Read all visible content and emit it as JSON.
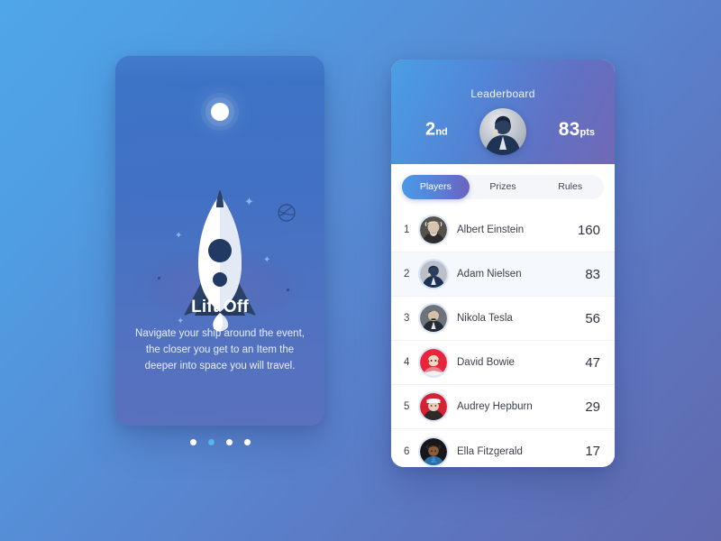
{
  "background": {
    "gradient_from": "#4fa6e8",
    "gradient_to": "#6069ae"
  },
  "onboarding_card": {
    "title": "Lift Off",
    "body": "Navigate your ship around the event, the closer you get to an Item the deeper into space you will travel.",
    "illustration": {
      "sun_label": "sun",
      "rocket_label": "rocket",
      "planet_label": "planet",
      "satellite_label": "satellite"
    },
    "pagination": {
      "total": 4,
      "active_index": 1
    },
    "colors": {
      "card_from": "#3c74c7",
      "card_to": "#5a71bd",
      "active_dot": "#52b6f0",
      "inactive_dot": "#ffffff"
    }
  },
  "leaderboard_card": {
    "header": {
      "title": "Leaderboard",
      "rank_value": "2",
      "rank_suffix": "nd",
      "points_value": "83",
      "points_suffix": "pts",
      "avatar_label": "current-user-avatar"
    },
    "tabs": [
      {
        "label": "Players",
        "active": true
      },
      {
        "label": "Prizes",
        "active": false
      },
      {
        "label": "Rules",
        "active": false
      }
    ],
    "players": [
      {
        "rank": "1",
        "name": "Albert Einstein",
        "score": "160",
        "highlight": false,
        "avatar_bg": "#5c5a56",
        "avatar_label": "avatar-albert-einstein"
      },
      {
        "rank": "2",
        "name": "Adam Nielsen",
        "score": "83",
        "highlight": true,
        "avatar_bg": "#2b4c78",
        "avatar_label": "avatar-adam-nielsen"
      },
      {
        "rank": "3",
        "name": "Nikola Tesla",
        "score": "56",
        "highlight": false,
        "avatar_bg": "#6e737a",
        "avatar_label": "avatar-nikola-tesla"
      },
      {
        "rank": "4",
        "name": "David Bowie",
        "score": "47",
        "highlight": false,
        "avatar_bg": "#e8253c",
        "avatar_label": "avatar-david-bowie"
      },
      {
        "rank": "5",
        "name": "Audrey Hepburn",
        "score": "29",
        "highlight": false,
        "avatar_bg": "#d81f33",
        "avatar_label": "avatar-audrey-hepburn"
      },
      {
        "rank": "6",
        "name": "Ella Fitzgerald",
        "score": "17",
        "highlight": false,
        "avatar_bg": "#1b1b1f",
        "avatar_label": "avatar-ella-fitzgerald"
      }
    ],
    "colors": {
      "header_from": "#4a9fe3",
      "header_to": "#7168b6",
      "active_tab_from": "#4a9ae8",
      "active_tab_to": "#6a63c0",
      "highlight_row": "#f5f8fd"
    }
  }
}
